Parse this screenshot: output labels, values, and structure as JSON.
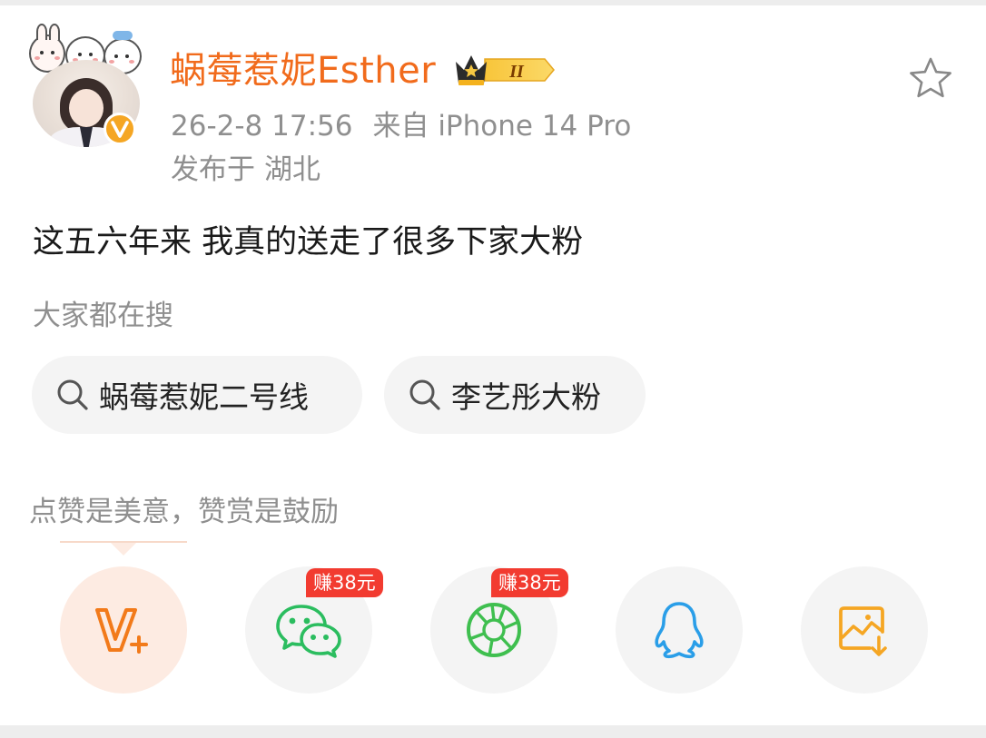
{
  "post": {
    "username": "蜗莓惹妮Esther",
    "member_level": "II",
    "timestamp": "26-2-8 17:56",
    "source": "来自 iPhone 14 Pro",
    "location_prefix": "发布于",
    "location": "湖北",
    "text": "这五六年来 我真的送走了很多下家大粉"
  },
  "search": {
    "heading": "大家都在搜",
    "chips": [
      "蜗莓惹妮二号线",
      "李艺彤大粉"
    ]
  },
  "like_tip": "点赞是美意，赞赏是鼓励",
  "share_row": {
    "items": [
      {
        "icon": "v-plus-icon",
        "badge": ""
      },
      {
        "icon": "wechat-icon",
        "badge": "赚38元"
      },
      {
        "icon": "moments-icon",
        "badge": "赚38元"
      },
      {
        "icon": "qq-icon",
        "badge": ""
      },
      {
        "icon": "save-image-icon",
        "badge": ""
      }
    ]
  },
  "colors": {
    "username": "#f16b1c",
    "meta": "#8f8f8f",
    "chip_bg": "#f4f4f4",
    "earn_badge": "#f23b30",
    "vip_orange": "#f5a623"
  }
}
